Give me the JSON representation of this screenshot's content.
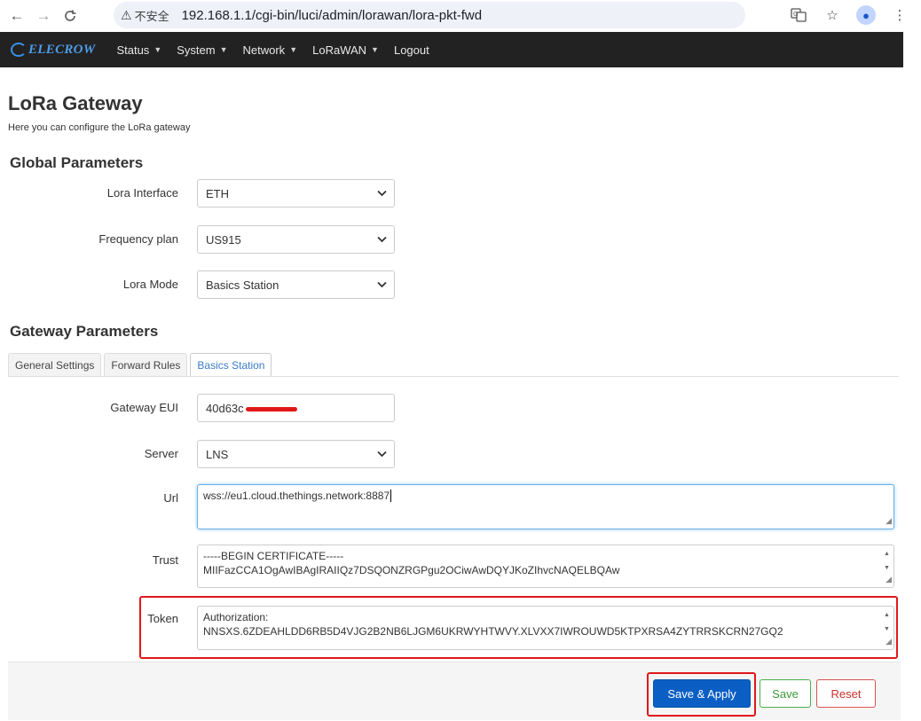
{
  "browser": {
    "security_label": "不安全",
    "url": "192.168.1.1/cgi-bin/luci/admin/lorawan/lora-pkt-fwd"
  },
  "brand": {
    "name": "ELECROW"
  },
  "nav": {
    "items": [
      {
        "label": "Status",
        "has_menu": true
      },
      {
        "label": "System",
        "has_menu": true
      },
      {
        "label": "Network",
        "has_menu": true
      },
      {
        "label": "LoRaWAN",
        "has_menu": true
      },
      {
        "label": "Logout",
        "has_menu": false
      }
    ]
  },
  "page": {
    "title": "LoRa Gateway",
    "description": "Here you can configure the LoRa gateway"
  },
  "global": {
    "title": "Global Parameters",
    "lora_interface": {
      "label": "Lora Interface",
      "value": "ETH"
    },
    "frequency_plan": {
      "label": "Frequency plan",
      "value": "US915"
    },
    "lora_mode": {
      "label": "Lora Mode",
      "value": "Basics Station"
    }
  },
  "gateway": {
    "title": "Gateway Parameters",
    "tabs": [
      {
        "label": "General Settings",
        "active": false
      },
      {
        "label": "Forward Rules",
        "active": false
      },
      {
        "label": "Basics Station",
        "active": true
      }
    ],
    "eui": {
      "label": "Gateway EUI",
      "value": "40d63c"
    },
    "server": {
      "label": "Server",
      "value": "LNS"
    },
    "url": {
      "label": "Url",
      "value": "wss://eu1.cloud.thethings.network:8887"
    },
    "trust": {
      "label": "Trust",
      "line1": "-----BEGIN CERTIFICATE-----",
      "line2": "MIIFazCCA1OgAwIBAgIRAIIQz7DSQONZRGPgu2OCiwAwDQYJKoZIhvcNAQELBQAw"
    },
    "token": {
      "label": "Token",
      "line1": "Authorization:",
      "line2": "NNSXS.6ZDEAHLDD6RB5D4VJG2B2NB6LJGM6UKRWYHTWVY.XLVXX7IWROUWD5KTPXRSA4ZYTRRSKCRN27GQ2"
    }
  },
  "actions": {
    "save_apply": "Save & Apply",
    "save": "Save",
    "reset": "Reset"
  },
  "colors": {
    "navbar_bg": "#222222",
    "primary": "#0b5fc4",
    "highlight": "#e0181b"
  }
}
